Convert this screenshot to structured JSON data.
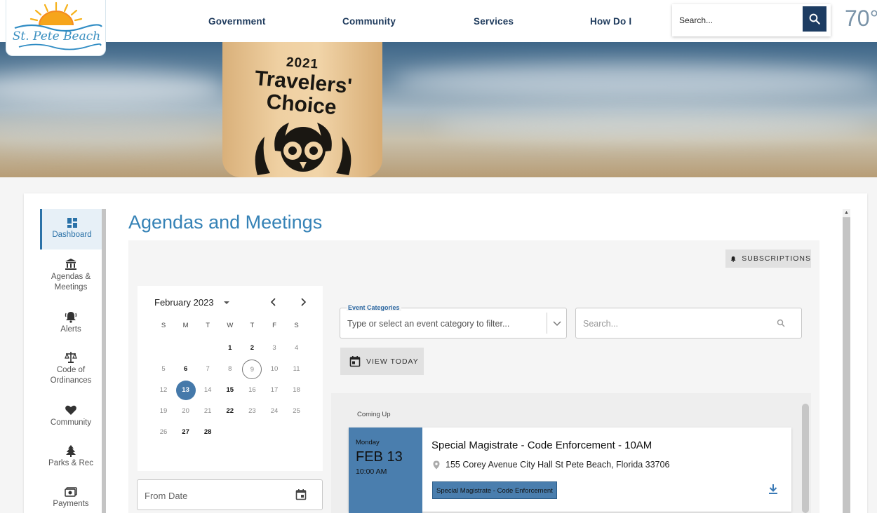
{
  "header": {
    "logo_text": "St. Pete Beach",
    "nav": [
      {
        "label": "Government"
      },
      {
        "label": "Community"
      },
      {
        "label": "Services"
      },
      {
        "label": "How Do I"
      }
    ],
    "search_placeholder": "Search...",
    "weather": "70°"
  },
  "hero": {
    "paddle_year": "2021",
    "paddle_line1": "Travelers'",
    "paddle_line2": "Choice"
  },
  "sidebar": {
    "items": [
      {
        "label": "Dashboard",
        "icon": "dashboard-icon"
      },
      {
        "label": "Agendas & Meetings",
        "icon": "bank-icon"
      },
      {
        "label": "Alerts",
        "icon": "bell-alert-icon"
      },
      {
        "label": "Code of Ordinances",
        "icon": "scales-icon"
      },
      {
        "label": "Community",
        "icon": "heart-hand-icon"
      },
      {
        "label": "Parks & Rec",
        "icon": "tree-icon"
      },
      {
        "label": "Payments",
        "icon": "money-icon"
      }
    ]
  },
  "page": {
    "title": "Agendas and Meetings",
    "subscriptions_label": "SUBSCRIPTIONS"
  },
  "calendar": {
    "month_label": "February 2023",
    "weekdays": [
      "S",
      "M",
      "T",
      "W",
      "T",
      "F",
      "S"
    ],
    "first_weekday": 3,
    "days_in_month": 28,
    "bold_days": [
      1,
      2,
      6,
      15,
      22,
      27,
      28
    ],
    "selected_day": 13,
    "today_day": 9
  },
  "from_date": {
    "placeholder": "From Date"
  },
  "filters": {
    "category_label": "Event Categories",
    "category_placeholder": "Type or select an event category to filter...",
    "search_placeholder": "Search...",
    "view_today_label": "VIEW TODAY"
  },
  "events": {
    "section_label": "Coming Up",
    "items": [
      {
        "weekday": "Monday",
        "month_day": "FEB 13",
        "time": "10:00 AM",
        "title": "Special Magistrate - Code Enforcement - 10AM",
        "location": "155 Corey Avenue City Hall St Pete Beach, Florida 33706",
        "tag": "Special Magistrate - Code Enforcement"
      }
    ]
  },
  "colors": {
    "accent": "#3582b6",
    "nav_text": "#1e3a5c",
    "event_date_bg": "#4a7eae",
    "selected_day": "#4579aa"
  }
}
